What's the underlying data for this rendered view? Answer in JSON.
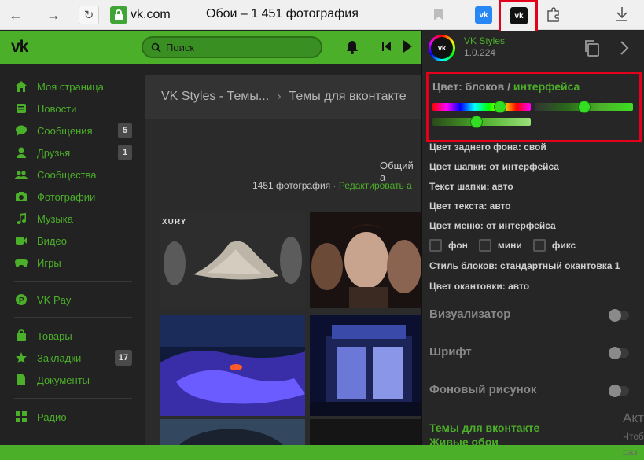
{
  "browser": {
    "back_glyph": "←",
    "forward_glyph": "→",
    "reload_glyph": "↻",
    "url": "vk.com",
    "page_title": "Обои – 1 451 фотография",
    "extension_small_label": "vk",
    "extension_big_label": "vk",
    "accent": "#e3001b"
  },
  "vk_header": {
    "logo": "vk",
    "search_placeholder": "Поиск",
    "brand_color": "#4caf2a"
  },
  "sidebar": {
    "items": [
      {
        "label": "Моя страница",
        "icon": "home-icon",
        "glyph": "⌂"
      },
      {
        "label": "Новости",
        "icon": "news-icon",
        "glyph": "▤"
      },
      {
        "label": "Сообщения",
        "icon": "messages-icon",
        "glyph": "●",
        "count": "5"
      },
      {
        "label": "Друзья",
        "icon": "friends-icon",
        "glyph": "●",
        "count": "1"
      },
      {
        "label": "Сообщества",
        "icon": "communities-icon",
        "glyph": "●"
      },
      {
        "label": "Фотографии",
        "icon": "camera-icon",
        "glyph": "■"
      },
      {
        "label": "Музыка",
        "icon": "music-icon",
        "glyph": "♫"
      },
      {
        "label": "Видео",
        "icon": "video-icon",
        "glyph": "▶"
      },
      {
        "label": "Игры",
        "icon": "games-icon",
        "glyph": "◆"
      },
      {
        "label": "VK Pay",
        "icon": "vkpay-icon",
        "glyph": "P"
      },
      {
        "label": "Товары",
        "icon": "goods-icon",
        "glyph": "■"
      },
      {
        "label": "Закладки",
        "icon": "bookmarks-icon",
        "glyph": "★",
        "count": "17"
      },
      {
        "label": "Документы",
        "icon": "documents-icon",
        "glyph": "▭"
      },
      {
        "label": "Радио",
        "icon": "radio-icon",
        "glyph": "▦"
      }
    ]
  },
  "content": {
    "breadcrumbs": [
      "VK Styles - Темы...",
      "Темы для вконтакте"
    ],
    "album_description": "Общий а",
    "photo_count": "1451 фотография",
    "separator": "·",
    "edit_link": "Редактировать а",
    "photo_caption": "XURY"
  },
  "extension": {
    "name": "VK Styles",
    "version": "1.0.224",
    "logo": "vk",
    "color_heading": "Цвет: блоков /",
    "color_heading_accent": "интерфейса",
    "hue_level": 0.62,
    "settings": [
      "Цвет заднего фона: свой",
      "Цвет шапки: от интерфейса",
      "Текст шапки: авто",
      "Цвет текста: авто",
      "Цвет меню: от интерфейса"
    ],
    "checkboxes": [
      "фон",
      "мини",
      "фикс"
    ],
    "block_style": "Стиль блоков: стандартный окантовка 1",
    "border_color": "Цвет окантовки: авто",
    "sections": [
      "Визуализатор",
      "Шрифт",
      "Фоновый рисунок"
    ],
    "links": [
      "Темы для вконтакте",
      "Живые обои"
    ]
  },
  "watermark": {
    "line1": "Акт",
    "line2": "Чтоб",
    "line3": "раз"
  }
}
